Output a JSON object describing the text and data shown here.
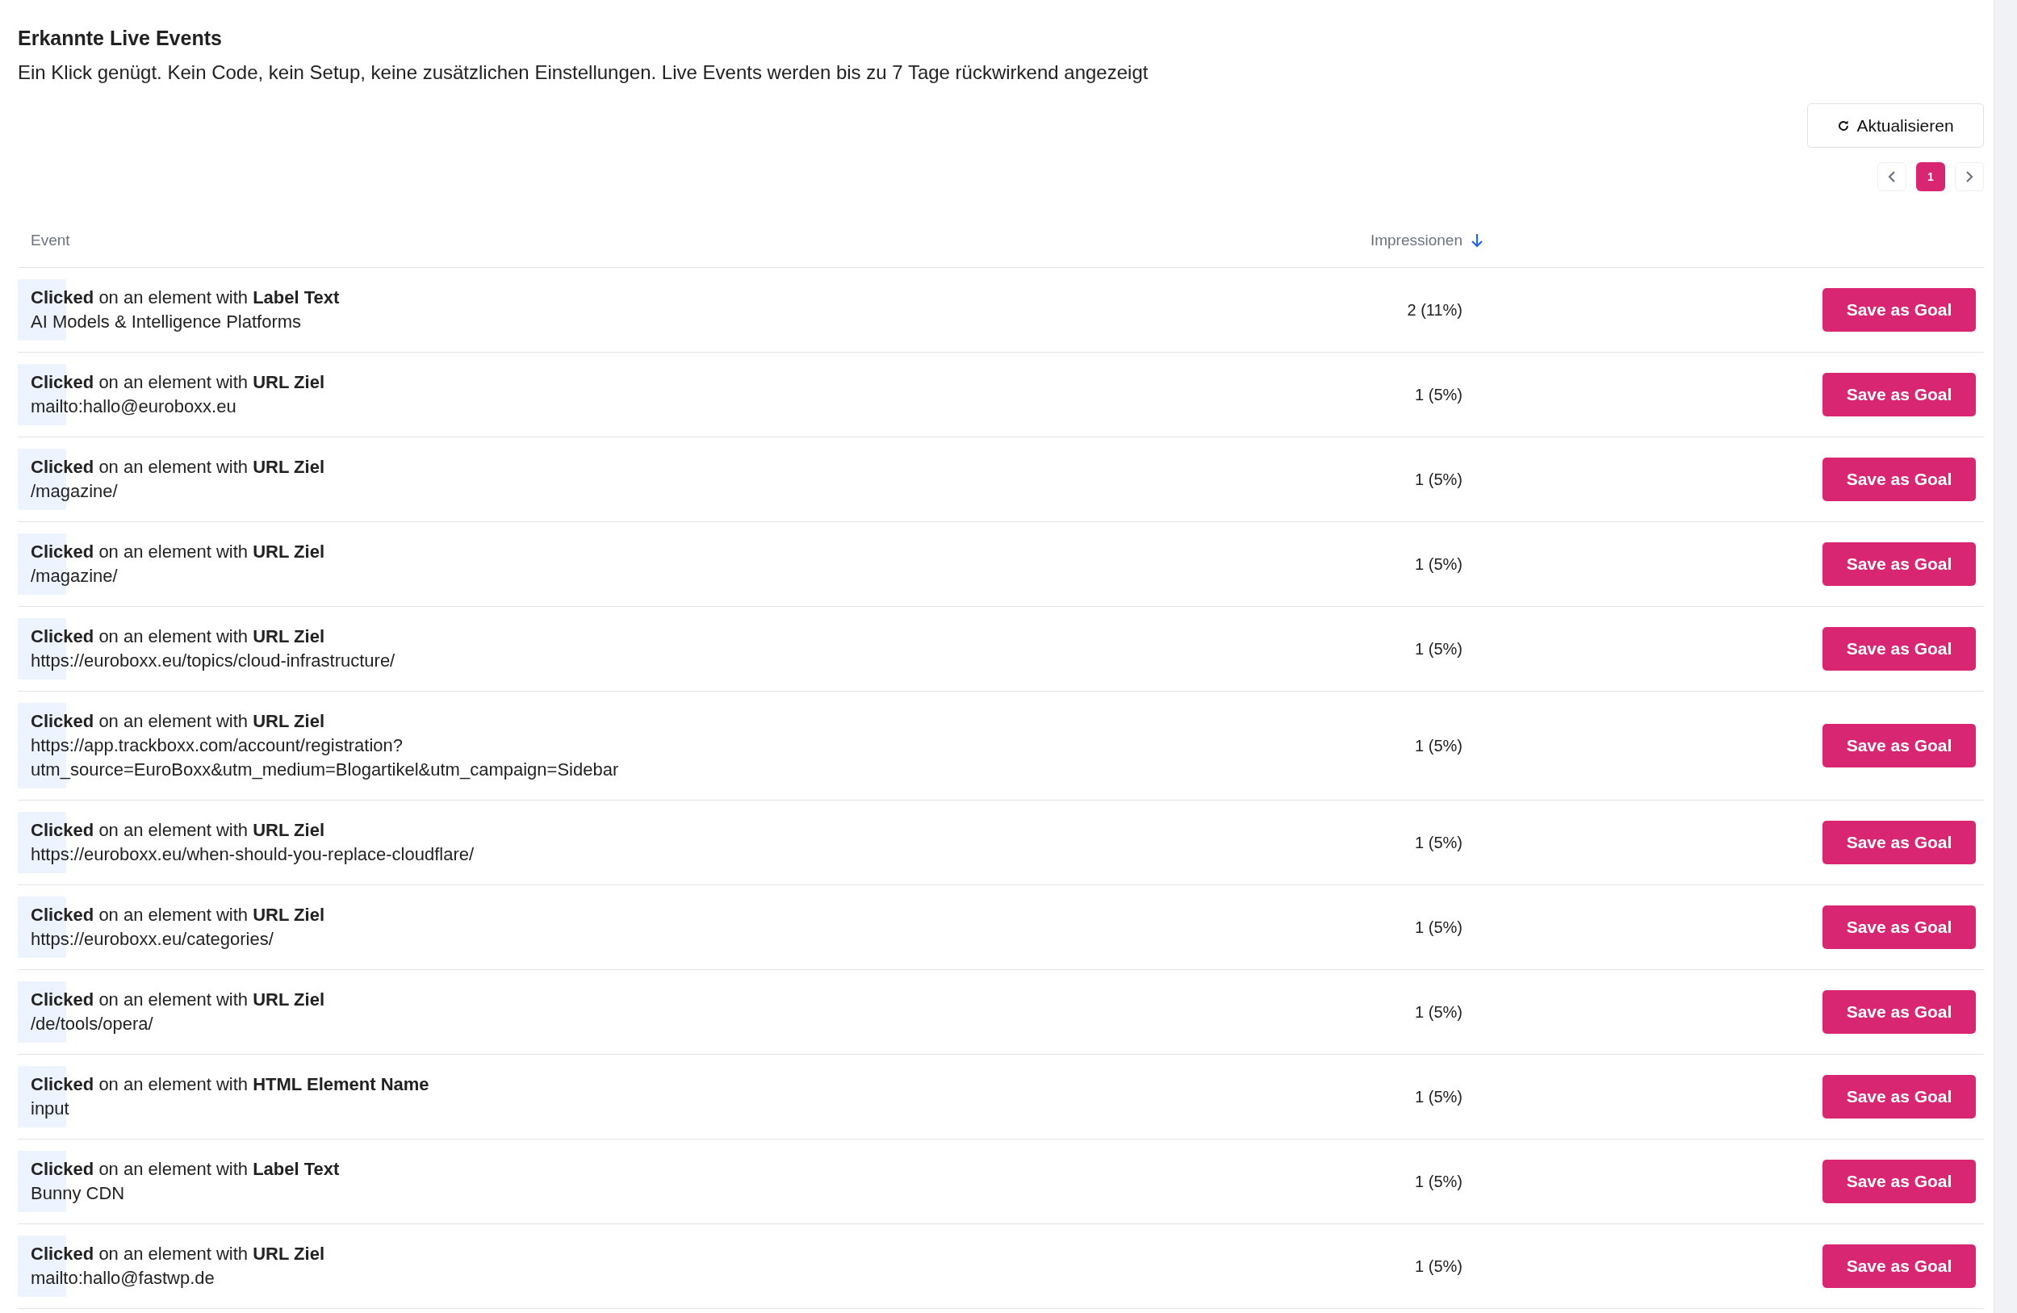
{
  "header": {
    "title": "Erkannte Live Events",
    "description": "Ein Klick genügt. Kein Code, kein Setup, keine zusätzlichen Einstellungen. Live Events werden bis zu 7 Tage rückwirkend angezeigt"
  },
  "refresh_button": {
    "label": "Aktualisieren"
  },
  "pagination": {
    "pages": [
      {
        "label": "1",
        "selected": true
      }
    ]
  },
  "table": {
    "columns": [
      {
        "label": "Event",
        "sorted": false
      },
      {
        "label": "Impressionen",
        "sorted": true
      }
    ],
    "rows": [
      {
        "event": "**Clicked** on an element with **Label Text**",
        "detail": "AI Models & Intelligence Platforms",
        "impressions": "2 (11%)",
        "action": "Save as Goal"
      },
      {
        "event": "**Clicked** on an element with **URL Ziel**",
        "detail": "mailto:hallo@euroboxx.eu",
        "impressions": "1 (5%)",
        "action": "Save as Goal"
      },
      {
        "event": "**Clicked** on an element with **URL Ziel**",
        "detail": "/magazine/",
        "impressions": "1 (5%)",
        "action": "Save as Goal"
      },
      {
        "event": "**Clicked** on an element with **URL Ziel**",
        "detail": "/magazine/",
        "impressions": "1 (5%)",
        "action": "Save as Goal"
      },
      {
        "event": "**Clicked** on an element with **URL Ziel**",
        "detail": "https://euroboxx.eu/topics/cloud-infrastructure/",
        "impressions": "1 (5%)",
        "action": "Save as Goal"
      },
      {
        "event": "**Clicked** on an element with **URL Ziel**",
        "detail": "https://app.trackboxx.com/account/registration?\nutm_source=EuroBoxx&utm_medium=Blogartikel&utm_campaign=Sidebar",
        "impressions": "1 (5%)",
        "action": "Save as Goal"
      },
      {
        "event": "**Clicked** on an element with **URL Ziel**",
        "detail": "https://euroboxx.eu/when-should-you-replace-cloudflare/",
        "impressions": "1 (5%)",
        "action": "Save as Goal"
      },
      {
        "event": "**Clicked** on an element with **URL Ziel**",
        "detail": "https://euroboxx.eu/categories/",
        "impressions": "1 (5%)",
        "action": "Save as Goal"
      },
      {
        "event": "**Clicked** on an element with **URL Ziel**",
        "detail": "/de/tools/opera/",
        "impressions": "1 (5%)",
        "action": "Save as Goal"
      },
      {
        "event": "**Clicked** on an element with **HTML Element Name**",
        "detail": "input",
        "impressions": "1 (5%)",
        "action": "Save as Goal"
      },
      {
        "event": "**Clicked** on an element with **Label Text**",
        "detail": "Bunny CDN",
        "impressions": "1 (5%)",
        "action": "Save as Goal"
      },
      {
        "event": "**Clicked** on an element with **URL Ziel**",
        "detail": "mailto:hallo@fastwp.de",
        "impressions": "1 (5%)",
        "action": "Save as Goal"
      }
    ]
  }
}
